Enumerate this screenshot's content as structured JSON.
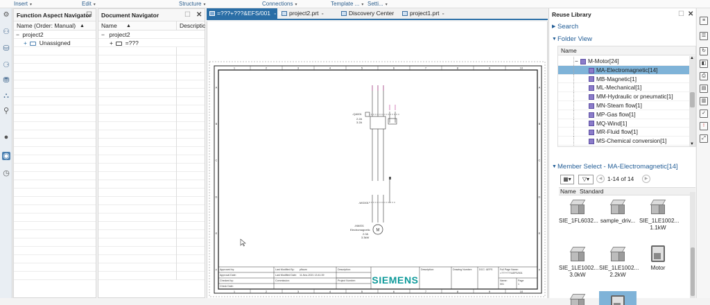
{
  "menubar": {
    "items": [
      {
        "label": "Insert",
        "caret": "▾"
      },
      {
        "label": "Edit",
        "caret": "▾"
      },
      {
        "label": "Structure",
        "caret": "▾"
      },
      {
        "label": "Connections",
        "caret": "▾"
      },
      {
        "label": "Template ...",
        "caret": "▾"
      },
      {
        "label": "Setti...",
        "caret": "▾"
      }
    ]
  },
  "function_panel": {
    "title": "Function Aspect Navigator",
    "column": "Name (Order: Manual)",
    "sort_arrow": "▲",
    "tree": [
      {
        "label": "project2",
        "toggle": "−"
      },
      {
        "label": "Unassigned",
        "toggle": "+"
      }
    ]
  },
  "document_panel": {
    "title": "Document Navigator",
    "columns": [
      "Name",
      "Descriptic"
    ],
    "sort_arrow": "▲",
    "tree": [
      {
        "label": "project2",
        "toggle": "−"
      },
      {
        "label": "=???",
        "toggle": "+"
      }
    ]
  },
  "tabs": [
    {
      "label": "=???+???&EFS/001",
      "active": true
    },
    {
      "label": "project2.prt",
      "active": false
    },
    {
      "label": "Discovery Center",
      "active": false
    },
    {
      "label": "project1.prt",
      "active": false
    }
  ],
  "drawing": {
    "ruler_numbers": [
      "1",
      "2",
      "3",
      "4",
      "5",
      "6",
      "7",
      "8",
      "9",
      "10"
    ],
    "row_letters": [
      "A",
      "B",
      "C",
      "D",
      "E",
      "F"
    ],
    "circuit_labels": {
      "breaker": "-QA001",
      "breaker_rating_1": "2.2A",
      "breaker_rating_2": "3.2A",
      "sensor": "-WG001",
      "motor_id": "-MA001",
      "motor_name": "Electromagnetic",
      "motor_v1": "2.0A",
      "motor_v2": "3.3kW"
    },
    "titleblock": {
      "approved_by": "Approved by:",
      "approval_date": "Approval Date:",
      "checked_by": "Checked by:",
      "check_date": "Check Date:",
      "last_modified_by": "Last Modified By:",
      "last_modified_by_value": "pflaum",
      "last_modified_date": "Last Modified Date:",
      "last_modified_date_value": "11-Nov-2021 13:41:39",
      "commission": "Commission:",
      "description": "Description:",
      "project_number": "Project Number:",
      "brand": "SIEMENS",
      "description2": "Description:",
      "drawing_number": "Drawing Number:",
      "doc": "DCC:",
      "doc_value": "&EFS",
      "full_page_name": "Full Page Name:",
      "full_page_value": "=???+???&EFS/001",
      "page": "Page",
      "page_value": "1",
      "name": "Name:",
      "name_value": "001"
    }
  },
  "reuse_library": {
    "title": "Reuse Library",
    "search_label": "Search",
    "folder_view_label": "Folder View",
    "folder_column": "Name",
    "folder_tree": [
      {
        "label": "M-Motor[24]",
        "level": 0,
        "selected": false
      },
      {
        "label": "MA-Electromagnetic[14]",
        "level": 1,
        "selected": true
      },
      {
        "label": "MB-Magnetic[1]",
        "level": 1,
        "selected": false
      },
      {
        "label": "ML-Mechanical[1]",
        "level": 1,
        "selected": false
      },
      {
        "label": "MM-Hydraulic or pneumatic[1]",
        "level": 1,
        "selected": false
      },
      {
        "label": "MN-Steam flow[1]",
        "level": 1,
        "selected": false
      },
      {
        "label": "MP-Gas flow[1]",
        "level": 1,
        "selected": false
      },
      {
        "label": "MQ-Wind[1]",
        "level": 1,
        "selected": false
      },
      {
        "label": "MR-Fluid flow[1]",
        "level": 1,
        "selected": false
      },
      {
        "label": "MS-Chemical conversion[1]",
        "level": 1,
        "selected": false
      }
    ],
    "member_select_label": "Member Select - MA-Electromagnetic[14]",
    "paging": "1-14 of 14",
    "member_columns": [
      "Name",
      "Standard"
    ],
    "members": [
      {
        "name": "SIE_1FL6032...",
        "kind": "cube"
      },
      {
        "name": "sample_driv...",
        "kind": "cube"
      },
      {
        "name": "SIE_1LE1002...\n1.1kW",
        "kind": "cube"
      },
      {
        "name": "SIE_1LE1002...\n3.0kW",
        "kind": "cube"
      },
      {
        "name": "SIE_1LE1002...\n2.2kW",
        "kind": "cube"
      },
      {
        "name": "Motor",
        "kind": "box"
      }
    ]
  }
}
